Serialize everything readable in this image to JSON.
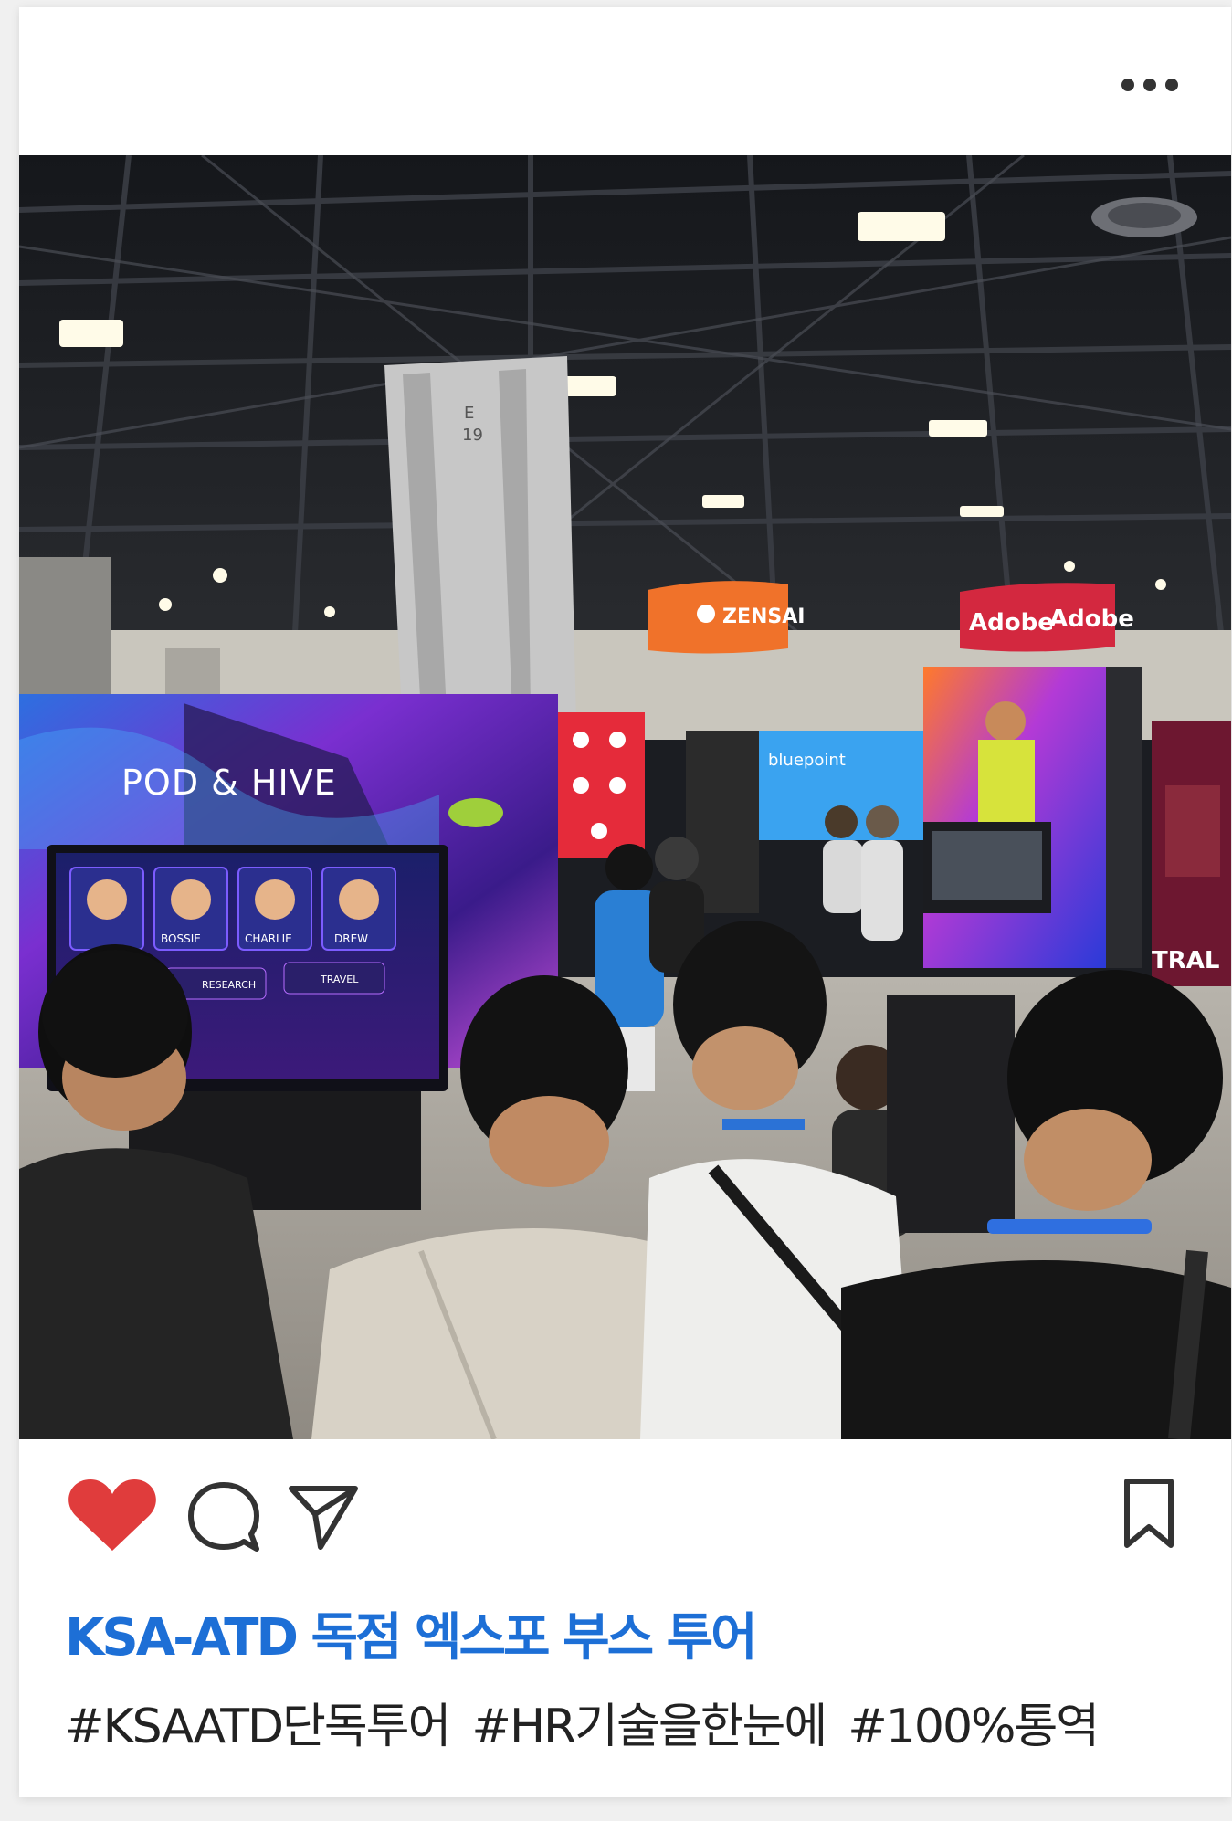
{
  "post": {
    "photo": {
      "pillar_sign": "E\n19",
      "booth_screen_title": "POD & HIVE",
      "screen_names": [
        "BOSSIE",
        "CHARLIE",
        "DREW"
      ],
      "screen_buttons": [
        "RESEARCH",
        "TRAVEL"
      ],
      "banner_zensai": "ZENSAI",
      "banner_adobe_left": "Adobe",
      "banner_adobe_right": "Adobe",
      "booth_blueprint": "bluepoint",
      "side_sign": "TRAL"
    },
    "actions": {
      "liked": true,
      "like_color": "#e03c3c",
      "accent_color": "#1d6fd6"
    },
    "caption": {
      "title": "KSA-ATD 독점 엑스포 부스 투어",
      "tags": [
        "#KSAATD단독투어",
        "#HR기술을한눈에",
        "#100%통역"
      ]
    }
  }
}
